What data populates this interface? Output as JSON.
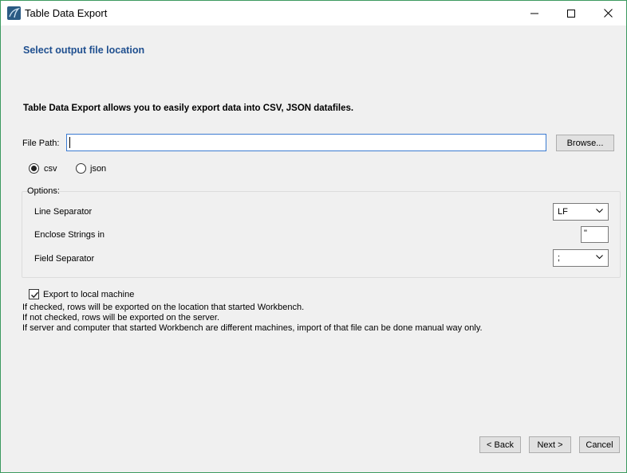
{
  "window": {
    "title": "Table Data Export",
    "controls": {
      "minimize": "minimize-icon",
      "maximize": "maximize-icon",
      "close": "close-icon"
    }
  },
  "page": {
    "heading": "Select output file location",
    "intro": "Table Data Export allows you to easily export data into CSV, JSON datafiles."
  },
  "file_path": {
    "label": "File Path:",
    "value": "",
    "browse_label": "Browse..."
  },
  "format": {
    "options": [
      {
        "label": "csv",
        "selected": true
      },
      {
        "label": "json",
        "selected": false
      }
    ]
  },
  "options": {
    "legend": "Options:",
    "line_separator": {
      "label": "Line Separator",
      "value": "LF"
    },
    "enclose_strings": {
      "label": "Enclose Strings in",
      "value": "\""
    },
    "field_separator": {
      "label": "Field Separator",
      "value": ";"
    }
  },
  "export_local": {
    "label": "Export to local machine",
    "checked": true,
    "notes": [
      "If checked, rows will be exported on the location that started Workbench.",
      "If not checked, rows will be exported on the server.",
      "If server and computer that started Workbench are different machines, import of that file can be done manual way only."
    ]
  },
  "footer": {
    "back_label": "< Back",
    "next_label": "Next >",
    "cancel_label": "Cancel"
  },
  "colors": {
    "heading": "#1f4f8f",
    "window_border": "#3c9a5f",
    "focus_border": "#3b7bd1"
  }
}
